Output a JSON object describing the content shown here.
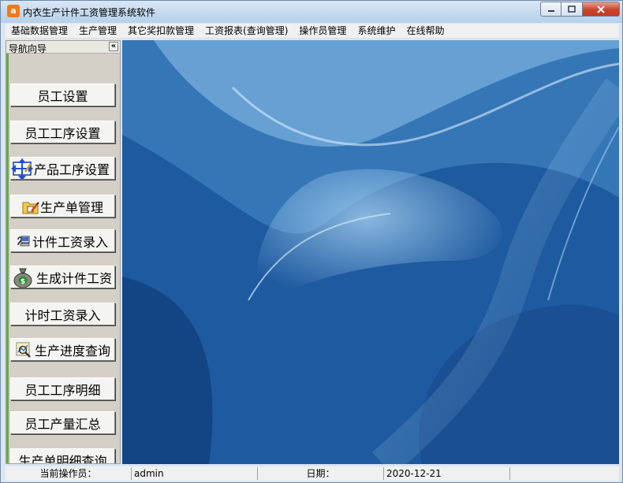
{
  "window": {
    "title": "内衣生产计件工资管理系统软件",
    "app_icon_letter": "a"
  },
  "menubar": {
    "items": [
      {
        "label": "基础数据管理"
      },
      {
        "label": "生产管理"
      },
      {
        "label": "其它奖扣款管理"
      },
      {
        "label": "工资报表(查询管理)"
      },
      {
        "label": "操作员管理"
      },
      {
        "label": "系统维护"
      },
      {
        "label": "在线帮助"
      }
    ]
  },
  "nav": {
    "title": "导航向导",
    "collapse_symbol": "«",
    "buttons": [
      {
        "label": "员工设置",
        "icon": "none"
      },
      {
        "label": "员工工序设置",
        "icon": "none"
      },
      {
        "label": "产品工序设置",
        "icon": "move-arrows-icon"
      },
      {
        "label": "生产单管理",
        "icon": "folder-edit-icon"
      },
      {
        "label": "计件工资录入",
        "icon": "computer-icon"
      },
      {
        "label": "生成计件工资",
        "icon": "money-bag-icon"
      },
      {
        "label": "计时工资录入",
        "icon": "none"
      },
      {
        "label": "生产进度查询",
        "icon": "chart-search-icon"
      },
      {
        "label": "员工工序明细",
        "icon": "none"
      },
      {
        "label": "员工产量汇总",
        "icon": "none"
      },
      {
        "label": "生产单明细查询",
        "icon": "none"
      }
    ]
  },
  "statusbar": {
    "operator_label": "当前操作员：",
    "operator_value": "admin",
    "date_label": "日期：",
    "date_value": "2020-12-21"
  },
  "colors": {
    "desktop_blue": "#1f5ea6",
    "nav_bg": "#d4d0c8",
    "close_red": "#c9452d"
  }
}
